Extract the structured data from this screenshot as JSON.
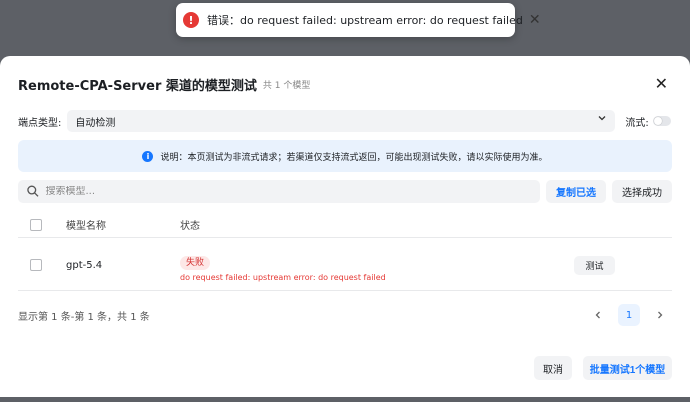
{
  "toast": {
    "message": "错误：do request failed: upstream error: do request failed",
    "icon": "error-icon",
    "color": "#e53935"
  },
  "modal": {
    "title": "Remote-CPA-Server 渠道的模型测试",
    "subtitle": "共 1 个模型",
    "endpoint_label": "端点类型:",
    "endpoint_value": "自动检测",
    "stream_label": "流式:",
    "stream_enabled": false,
    "info_text": "说明：本页测试为非流式请求；若渠道仅支持流式返回，可能出现测试失败，请以实际使用为准。",
    "search_placeholder": "搜索模型...",
    "copy_selected_label": "复制已选",
    "select_success_label": "选择成功",
    "table": {
      "columns": [
        "模型名称",
        "状态"
      ],
      "rows": [
        {
          "model": "gpt-5.4",
          "status": "失败",
          "error": "do request failed: upstream error: do request failed",
          "action": "测试"
        }
      ]
    },
    "pagination": {
      "summary": "显示第 1 条-第 1 条，共 1 条",
      "current_page": "1"
    },
    "cancel_label": "取消",
    "batch_test_label": "批量测试1个模型",
    "accent_color": "#1677ff"
  }
}
